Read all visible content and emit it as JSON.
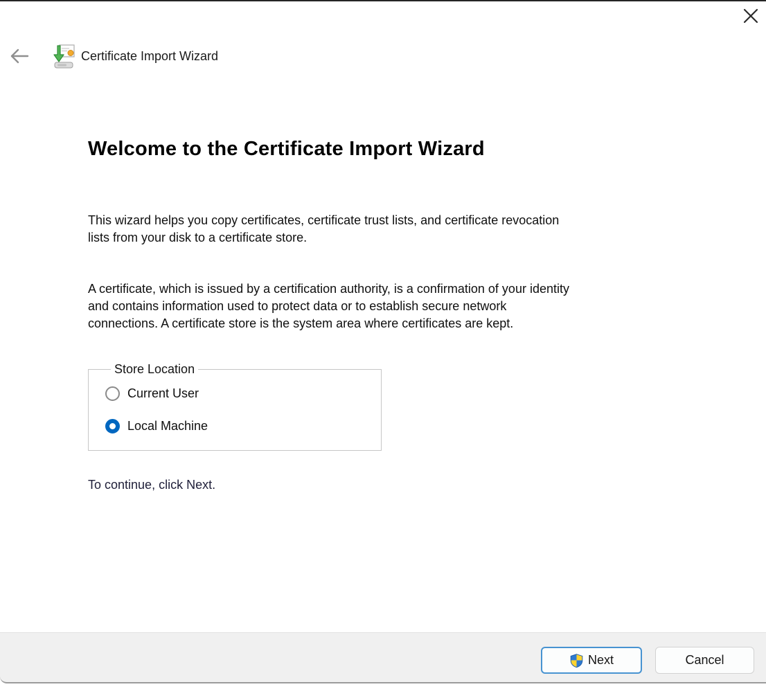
{
  "window": {
    "title": "Certificate Import Wizard"
  },
  "header": {
    "icons": [
      "back-arrow-icon",
      "certificate-import-icon",
      "close-icon"
    ]
  },
  "content": {
    "heading": "Welcome to the Certificate Import Wizard",
    "intro_lines": [
      "This wizard helps you copy certificates, certificate trust lists, and certificate revocation",
      "lists from your disk to a certificate store."
    ],
    "description_lines": [
      "A certificate, which is issued by a certification authority, is a confirmation of your identity",
      "and contains information used to protect data or to establish secure network",
      "connections. A certificate store is the system area where certificates are kept."
    ],
    "instruction": "To continue, click Next."
  },
  "store_location": {
    "legend": "Store Location",
    "options": [
      {
        "label": "Current User",
        "selected": false
      },
      {
        "label": "Local Machine",
        "selected": true
      }
    ]
  },
  "footer": {
    "next_label": "Next",
    "cancel_label": "Cancel",
    "next_requires_elevation": "uac-shield-icon"
  },
  "colors": {
    "accent": "#0067c0",
    "next_border": "#4793d1",
    "footer_bg": "#f0f0f0",
    "shield_blue": "#2e7ad1",
    "shield_yellow": "#fed32f"
  }
}
